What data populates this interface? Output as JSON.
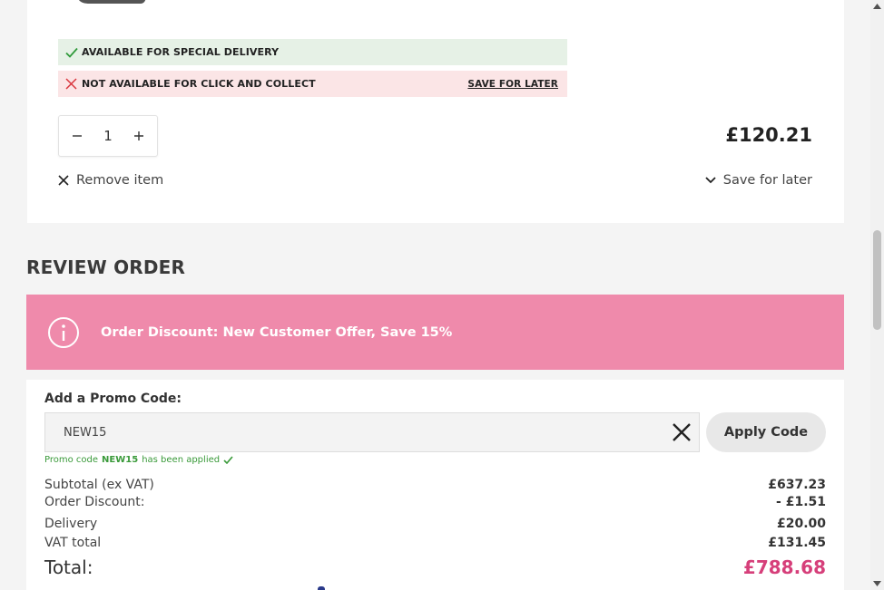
{
  "cart_item": {
    "special_delivery": "AVAILABLE FOR SPECIAL DELIVERY",
    "click_collect": "NOT AVAILABLE FOR CLICK AND COLLECT",
    "save_for_later_link": "SAVE FOR LATER",
    "quantity": "1",
    "price": "£120.21",
    "remove_label": "Remove item",
    "save_for_later_label": "Save for later"
  },
  "review": {
    "title": "REVIEW ORDER",
    "banner_text": "Order Discount: New Customer Offer, Save 15%",
    "promo": {
      "label": "Add a Promo Code:",
      "value": "NEW15",
      "apply_label": "Apply Code",
      "msg_before": "Promo code",
      "msg_code": "NEW15",
      "msg_after": "has been applied"
    },
    "lines": [
      {
        "label": "Subtotal (ex VAT)",
        "value": "£637.23"
      },
      {
        "label": "Order Discount:",
        "value": "- £1.51"
      },
      {
        "label": "Delivery",
        "value": "£20.00"
      },
      {
        "label": "VAT total",
        "value": "£131.45"
      }
    ],
    "total": {
      "label": "Total:",
      "value": "£788.68"
    }
  },
  "colors": {
    "banner": "#ef8aab",
    "total_accent": "#d63f7a",
    "ok_bg": "#e6f1e6",
    "no_bg": "#fbe5e6",
    "promo_success": "#3a9a3a"
  },
  "icons": [
    "check-icon",
    "cross-icon",
    "minus-icon",
    "plus-icon",
    "close-icon",
    "chevron-down-icon",
    "info-icon"
  ]
}
